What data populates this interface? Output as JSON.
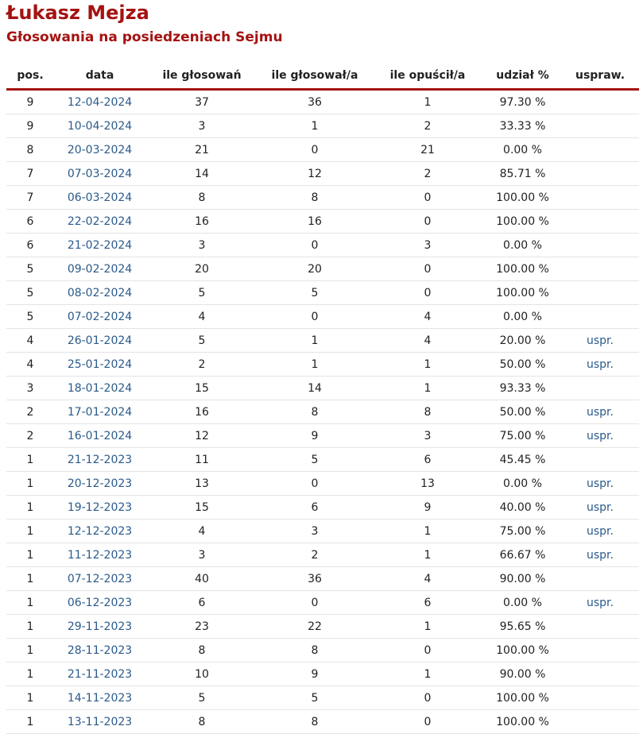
{
  "header": {
    "name": "Łukasz Mejza",
    "subtitle": "Głosowania na posiedzeniach Sejmu"
  },
  "colors": {
    "accent": "#a51212",
    "link": "#2a5a8a"
  },
  "table": {
    "columns": [
      "pos.",
      "data",
      "ile głosowań",
      "ile głosował/a",
      "ile opuścił/a",
      "udział %",
      "uspraw."
    ],
    "rows": [
      [
        "9",
        "12-04-2024",
        "37",
        "36",
        "1",
        "97.30 %",
        ""
      ],
      [
        "9",
        "10-04-2024",
        "3",
        "1",
        "2",
        "33.33 %",
        ""
      ],
      [
        "8",
        "20-03-2024",
        "21",
        "0",
        "21",
        "0.00 %",
        ""
      ],
      [
        "7",
        "07-03-2024",
        "14",
        "12",
        "2",
        "85.71 %",
        ""
      ],
      [
        "7",
        "06-03-2024",
        "8",
        "8",
        "0",
        "100.00 %",
        ""
      ],
      [
        "6",
        "22-02-2024",
        "16",
        "16",
        "0",
        "100.00 %",
        ""
      ],
      [
        "6",
        "21-02-2024",
        "3",
        "0",
        "3",
        "0.00 %",
        ""
      ],
      [
        "5",
        "09-02-2024",
        "20",
        "20",
        "0",
        "100.00 %",
        ""
      ],
      [
        "5",
        "08-02-2024",
        "5",
        "5",
        "0",
        "100.00 %",
        ""
      ],
      [
        "5",
        "07-02-2024",
        "4",
        "0",
        "4",
        "0.00 %",
        ""
      ],
      [
        "4",
        "26-01-2024",
        "5",
        "1",
        "4",
        "20.00 %",
        "uspr."
      ],
      [
        "4",
        "25-01-2024",
        "2",
        "1",
        "1",
        "50.00 %",
        "uspr."
      ],
      [
        "3",
        "18-01-2024",
        "15",
        "14",
        "1",
        "93.33 %",
        ""
      ],
      [
        "2",
        "17-01-2024",
        "16",
        "8",
        "8",
        "50.00 %",
        "uspr."
      ],
      [
        "2",
        "16-01-2024",
        "12",
        "9",
        "3",
        "75.00 %",
        "uspr."
      ],
      [
        "1",
        "21-12-2023",
        "11",
        "5",
        "6",
        "45.45 %",
        ""
      ],
      [
        "1",
        "20-12-2023",
        "13",
        "0",
        "13",
        "0.00 %",
        "uspr."
      ],
      [
        "1",
        "19-12-2023",
        "15",
        "6",
        "9",
        "40.00 %",
        "uspr."
      ],
      [
        "1",
        "12-12-2023",
        "4",
        "3",
        "1",
        "75.00 %",
        "uspr."
      ],
      [
        "1",
        "11-12-2023",
        "3",
        "2",
        "1",
        "66.67 %",
        "uspr."
      ],
      [
        "1",
        "07-12-2023",
        "40",
        "36",
        "4",
        "90.00 %",
        ""
      ],
      [
        "1",
        "06-12-2023",
        "6",
        "0",
        "6",
        "0.00 %",
        "uspr."
      ],
      [
        "1",
        "29-11-2023",
        "23",
        "22",
        "1",
        "95.65 %",
        ""
      ],
      [
        "1",
        "28-11-2023",
        "8",
        "8",
        "0",
        "100.00 %",
        ""
      ],
      [
        "1",
        "21-11-2023",
        "10",
        "9",
        "1",
        "90.00 %",
        ""
      ],
      [
        "1",
        "14-11-2023",
        "5",
        "5",
        "0",
        "100.00 %",
        ""
      ],
      [
        "1",
        "13-11-2023",
        "8",
        "8",
        "0",
        "100.00 %",
        ""
      ]
    ]
  }
}
